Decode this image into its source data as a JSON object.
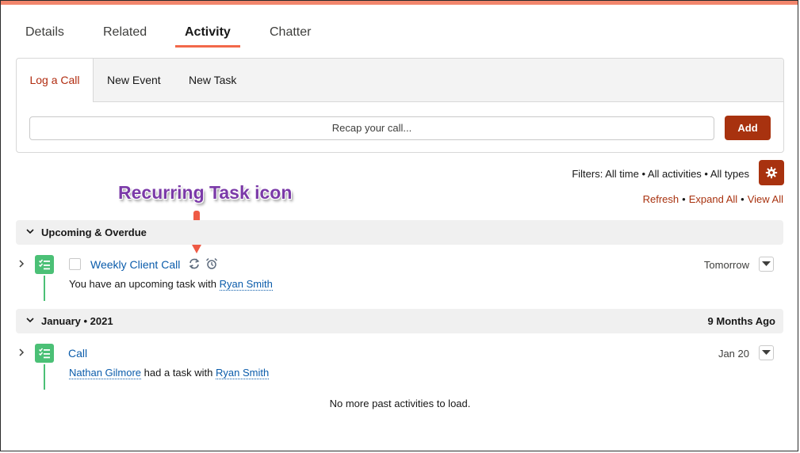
{
  "tabs": [
    {
      "label": "Details"
    },
    {
      "label": "Related"
    },
    {
      "label": "Activity"
    },
    {
      "label": "Chatter"
    }
  ],
  "composer": {
    "tabs": [
      {
        "label": "Log a Call"
      },
      {
        "label": "New Event"
      },
      {
        "label": "New Task"
      }
    ],
    "recap_placeholder": "Recap your call...",
    "add_label": "Add"
  },
  "filters": {
    "text": "Filters: All time • All activities • All types",
    "refresh": "Refresh",
    "expand_all": "Expand All",
    "view_all": "View All",
    "separator": "•"
  },
  "annotation": {
    "label": "Recurring Task icon",
    "color": "#7b3aa8",
    "arrow_color": "#ee5a45"
  },
  "sections": [
    {
      "title": "Upcoming & Overdue",
      "right": "",
      "items": [
        {
          "subject": "Weekly Client Call",
          "icons": [
            "recurring-icon",
            "alarm-icon"
          ],
          "date": "Tomorrow",
          "desc_prefix": "You have an upcoming task with",
          "desc_link": "Ryan Smith"
        }
      ]
    },
    {
      "title": "January • 2021",
      "right": "9 Months Ago",
      "items": [
        {
          "subject": "Call",
          "date": "Jan 20",
          "desc_link_1": "Nathan Gilmore",
          "desc_mid": "had a task with",
          "desc_link_2": "Ryan Smith"
        }
      ]
    }
  ],
  "footer": {
    "no_more": "No more past activities to load."
  },
  "colors": {
    "brand": "#a8320f",
    "link": "#0b5cab",
    "task_green": "#4bc076",
    "tab_underline": "#f2684a"
  }
}
